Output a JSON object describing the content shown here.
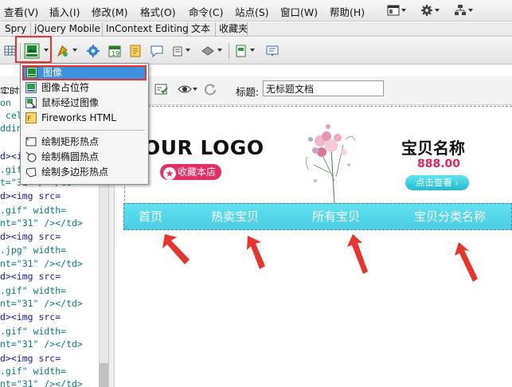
{
  "menubar": {
    "items": [
      "查看(V)",
      "插入(I)",
      "修改(M)",
      "格式(O)",
      "命令(C)",
      "站点(S)",
      "窗口(W)",
      "帮助(H)"
    ],
    "icons": [
      "layout-icon",
      "gear-icon",
      "site-icon"
    ]
  },
  "insert_tabs": [
    "Spry",
    "jQuery Mobile",
    "InContext Editing",
    "文本",
    "收藏夹"
  ],
  "toolbar": {
    "icons": [
      "table-icon",
      "image-icon",
      "media-icon",
      "widget-icon",
      "date-icon",
      "server-side-icon",
      "comment-icon",
      "head-icon",
      "script-icon",
      "template-icon",
      "tag-chooser-icon"
    ]
  },
  "image_menu": {
    "items": [
      {
        "label": "图像",
        "icon": "image-icon",
        "selected": true
      },
      {
        "label": "图像占位符",
        "icon": "image-placeholder-icon"
      },
      {
        "label": "鼠标经过图像",
        "icon": "rollover-image-icon"
      },
      {
        "label": "Fireworks HTML",
        "icon": "fireworks-icon"
      },
      {
        "label": "绘制矩形热点",
        "icon": "rect-hotspot-icon"
      },
      {
        "label": "绘制椭圆热点",
        "icon": "oval-hotspot-icon"
      },
      {
        "label": "绘制多边形热点",
        "icon": "polygon-hotspot-icon"
      }
    ]
  },
  "doc_toolbar": {
    "code_label": "实时打",
    "title_label": "标题:",
    "title_value": "无标题文档"
  },
  "code_lines": [
    "on",
    " cel",
    "ddin",
    "d><img src=",
    ".gif\" width=",
    "t=\"31\" /></td>",
    "d><img src=",
    ".gif\" width=",
    "nt=\"31\" /></td>",
    "d><img src=",
    ".jpg\" width=",
    "nt=\"31\" /></td>",
    "d><img src=",
    ".gif\" width=",
    "nt=\"31\" /></td>",
    "d><img src=",
    ".gif\" width=",
    "nt=\"31\" /></td>",
    "d><img src=",
    ".gif\" width=",
    "nt=\"31\" /></td>"
  ],
  "design": {
    "logo": "OUR LOGO",
    "favorite_button": "收藏本店",
    "product_name": "宝贝名称",
    "product_price": "888.00",
    "view_button": "点击查看",
    "nav": [
      "首页",
      "热卖宝贝",
      "所有宝贝",
      "宝贝分类名称"
    ]
  },
  "colors": {
    "accent_red": "#e8332f",
    "nav_cyan": "#4ccde6",
    "price_pink": "#e2245c",
    "selection_blue": "#3d8fe0"
  }
}
